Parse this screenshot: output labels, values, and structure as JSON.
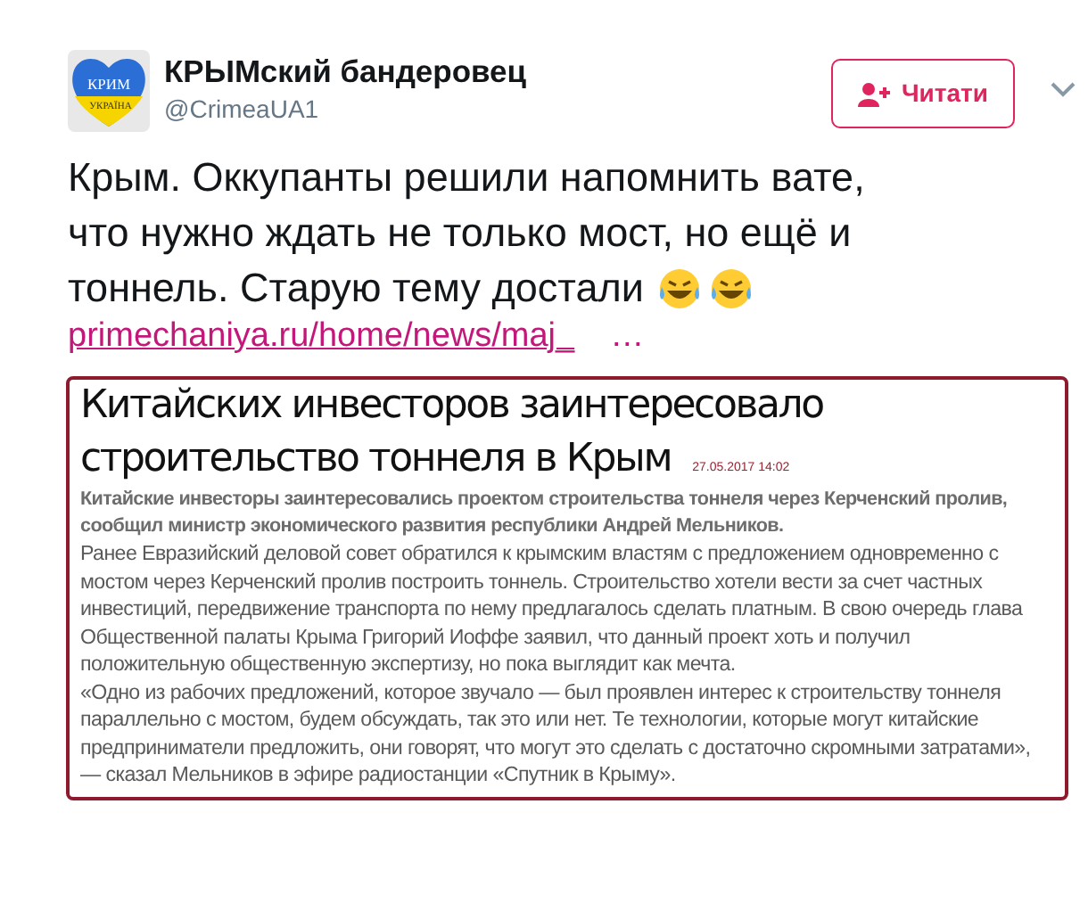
{
  "author": {
    "name": "КРЫМский бандеровец",
    "handle": "@CrimeaUA1",
    "avatar_labels": [
      "КРИМ",
      "УКРАЇНА"
    ]
  },
  "follow_button": {
    "label": "Читати"
  },
  "tweet": {
    "text_lines": [
      "Крым. Оккупанты решили напомнить вате,",
      "что нужно ждать не только мост, но ещё и",
      "тоннель. Старую тему достали"
    ],
    "link": "primechaniya.ru/home/news/maj_",
    "link_ellipsis": "…"
  },
  "article": {
    "headline_lines": [
      "Китайских инвесторов заинтересовало",
      "строительство тоннеля в Крым"
    ],
    "date": "27.05.2017 14:02",
    "lead": "Китайские инвесторы заинтересовались проектом строительства тоннеля через Керченский пролив, сообщил министр экономического развития республики Андрей Мельников.",
    "paragraphs": [
      "Ранее Евразийский деловой совет обратился к крымским властям с предложением одновременно с мостом через Керченский пролив построить тоннель. Строительство хотели вести за счет частных инвестиций, передвижение транспорта по нему предлагалось сделать платным. В свою очередь глава Общественной палаты Крыма Григорий Иоффе заявил, что данный проект хоть и получил положительную общественную экспертизу, но пока выглядит как мечта.",
      "«Одно из рабочих предложений, которое звучало — был проявлен интерес к строительству тоннеля параллельно с мостом, будем обсуждать, так это или нет. Те технологии, которые могут китайские предприниматели предложить, они говорят, что могут это сделать с достаточно скромными затратами», — сказал Мельников в эфире радиостанции «Спутник в Крыму»."
    ]
  }
}
